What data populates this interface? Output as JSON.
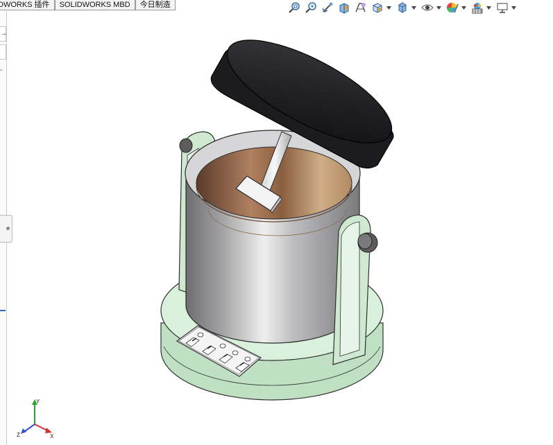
{
  "tabs": [
    "DWORKS 插件",
    "SOLIDWORKS MBD",
    "今日制造"
  ],
  "left_panel": {
    "glyph_arrow": "→",
    "glyph_dash": "-"
  },
  "heads_up_toolbar": {
    "buttons": [
      {
        "icon": "zoom-to-fit-icon"
      },
      {
        "icon": "zoom-to-area-icon"
      },
      {
        "icon": "previous-view-icon"
      },
      {
        "icon": "section-view-icon"
      },
      {
        "icon": "dynamic-annotation-views-icon"
      },
      {
        "icon": "view-orientation-icon",
        "dropdown": true
      },
      {
        "icon": "display-style-icon",
        "dropdown": true
      },
      {
        "icon": "hide-show-items-icon",
        "dropdown": true
      },
      {
        "icon": "edit-appearance-icon",
        "dropdown": true
      },
      {
        "icon": "apply-scene-icon",
        "dropdown": true
      },
      {
        "icon": "view-settings-icon",
        "dropdown": true
      }
    ]
  },
  "model": {
    "colors": {
      "base": "#d6efd6",
      "base_outline": "#3a3a3a",
      "cylinder": "#b9b9bb",
      "lid": "#2b2b2d",
      "bowl_inner": "#a5764d",
      "bracket": "#cdebcf"
    }
  },
  "triad": {
    "x_label": "X",
    "y_label": "Y",
    "z_label": "Z"
  }
}
